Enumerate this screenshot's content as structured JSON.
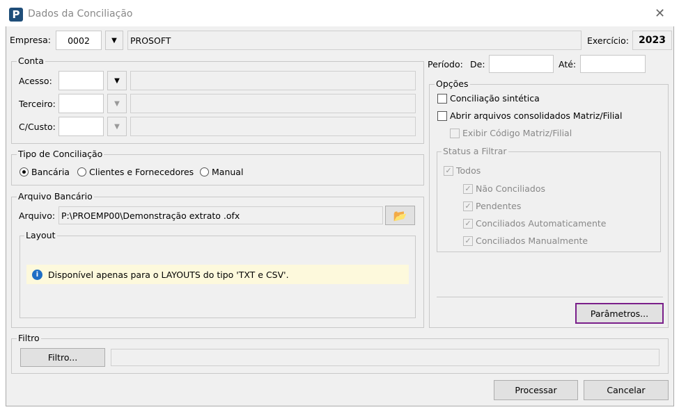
{
  "window": {
    "title": "Dados da Conciliação",
    "logo": "P"
  },
  "empresa": {
    "label": "Empresa:",
    "code": "0002",
    "name": "PROSOFT",
    "exercicio_label": "Exercício:",
    "exercicio": "2023"
  },
  "conta": {
    "title": "Conta",
    "rows": [
      {
        "label": "Acesso:"
      },
      {
        "label": "Terceiro:"
      },
      {
        "label": "C/Custo:"
      }
    ]
  },
  "tipo": {
    "title": "Tipo de Conciliação",
    "options": [
      "Bancária",
      "Clientes e Fornecedores",
      "Manual"
    ],
    "selected": 0
  },
  "arquivo": {
    "title": "Arquivo Bancário",
    "label": "Arquivo:",
    "value": "P:\\PROEMP00\\Demonstração extrato .ofx",
    "layout_title": "Layout",
    "info": "Disponível apenas para o LAYOUTS do tipo 'TXT e CSV'."
  },
  "periodo": {
    "label": "Período:",
    "de": "De:",
    "ate": "Até:"
  },
  "opcoes": {
    "title": "Opções",
    "sintetica": "Conciliação sintética",
    "abrir": "Abrir arquivos consolidados Matriz/Filial",
    "exibir": "Exibir Código Matriz/Filial",
    "status_title": "Status a Filtrar",
    "todos": "Todos",
    "status": [
      "Não Conciliados",
      "Pendentes",
      "Conciliados Automaticamente",
      "Conciliados Manualmente"
    ],
    "parametros": "Parâmetros..."
  },
  "filtro": {
    "title": "Filtro",
    "button": "Filtro..."
  },
  "footer": {
    "processar": "Processar",
    "cancelar": "Cancelar"
  },
  "colors": {
    "accent": "#7a1f8a",
    "info_bg": "#fdf9dc",
    "info_icon": "#1f6fc5"
  }
}
